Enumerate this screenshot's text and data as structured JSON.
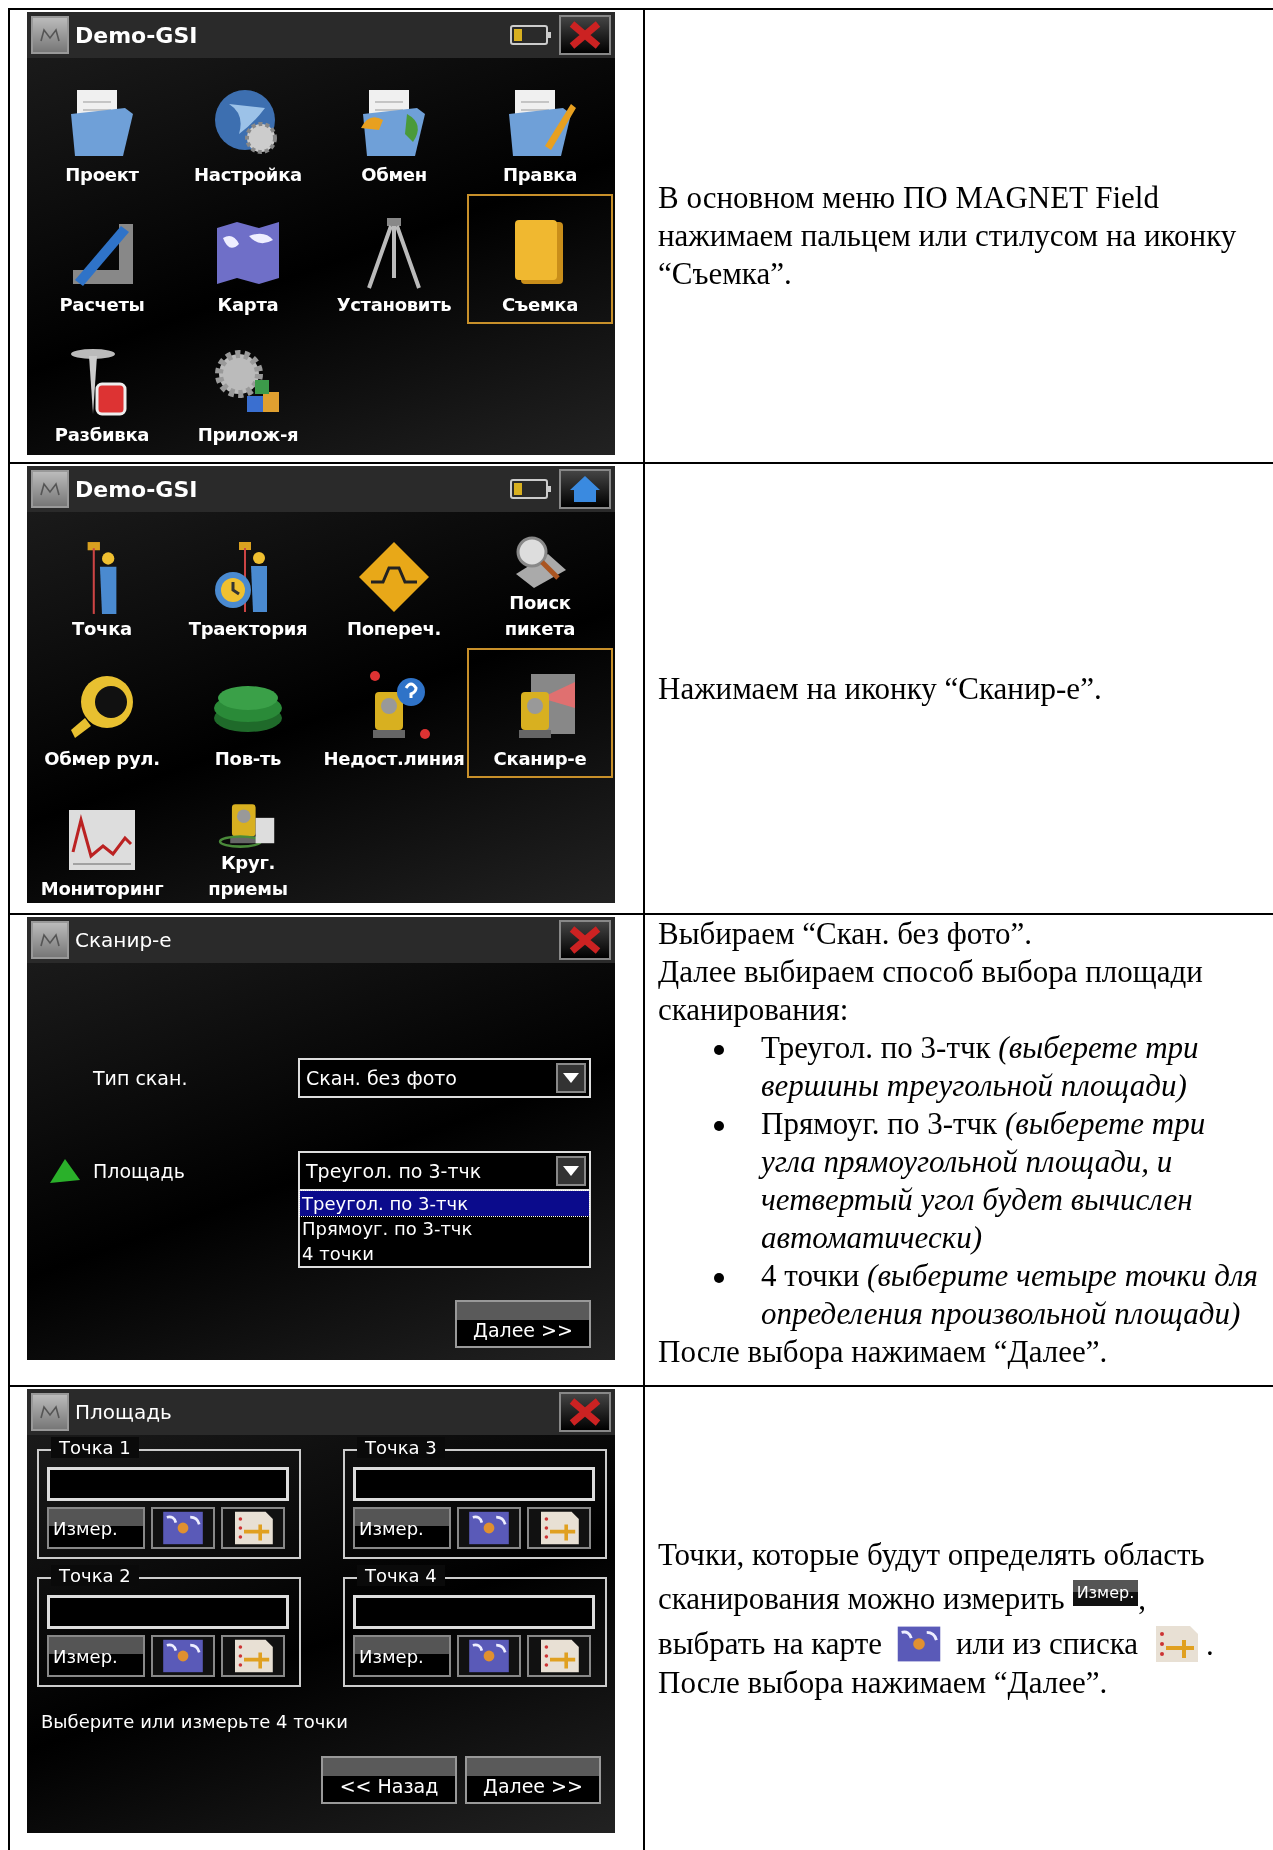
{
  "rows": [
    {
      "screen": {
        "kind": "menu",
        "title": "Demo-GSI",
        "corner_button": {
          "kind": "close"
        },
        "items": [
          {
            "label": "Проект",
            "selected": false
          },
          {
            "label": "Настройка",
            "selected": false
          },
          {
            "label": "Обмен",
            "selected": false
          },
          {
            "label": "Правка",
            "selected": false
          },
          {
            "label": "Расчеты",
            "selected": false
          },
          {
            "label": "Карта",
            "selected": false
          },
          {
            "label": "Установить",
            "selected": false
          },
          {
            "label": "Съемка",
            "selected": true
          },
          {
            "label": "Разбивка",
            "selected": false
          },
          {
            "label": "Прилож-я",
            "selected": false
          }
        ]
      },
      "description": [
        {
          "kind": "paragraph",
          "text": "В основном меню ПО MAGNET Field нажимаем пальцем или стилусом на иконку “Съемка”."
        }
      ]
    },
    {
      "screen": {
        "kind": "menu",
        "title": "Demo-GSI",
        "corner_button": {
          "kind": "home"
        },
        "items": [
          {
            "label": "Точка",
            "selected": false
          },
          {
            "label": "Траектория",
            "selected": false
          },
          {
            "label": "Попереч.",
            "selected": false
          },
          {
            "label": "Поиск\nпикета",
            "selected": false
          },
          {
            "label": "Обмер рул.",
            "selected": false
          },
          {
            "label": "Пов-ть",
            "selected": false
          },
          {
            "label": "Недост.линия",
            "selected": false
          },
          {
            "label": "Сканир-е",
            "selected": true
          },
          {
            "label": "Мониторинг",
            "selected": false
          },
          {
            "label": "Круг.\nприемы",
            "selected": false
          }
        ]
      },
      "description": [
        {
          "kind": "paragraph",
          "text": "Нажимаем на иконку “Сканир-е”."
        }
      ]
    },
    {
      "screen": {
        "kind": "form",
        "title": "Сканир-е",
        "corner_button": {
          "kind": "close"
        },
        "fields": [
          {
            "label": "Тип скан.",
            "value": "Скан. без фото"
          },
          {
            "label": "Площадь",
            "value": "Треугол. по 3-тчк",
            "options": [
              {
                "label": "Треугол. по 3-тчк",
                "selected": true
              },
              {
                "label": "Прямоуг. по 3-тчк",
                "selected": false
              },
              {
                "label": "4 точки",
                "selected": false
              }
            ]
          }
        ],
        "buttons": [
          "Далее >>"
        ]
      },
      "description": [
        {
          "kind": "paragraph",
          "text": "Выбираем “Скан. без фото”."
        },
        {
          "kind": "paragraph",
          "text": "Далее выбираем способ выбора площади сканирования:"
        },
        {
          "kind": "bullet",
          "text": "Треугол. по 3-тчк *(выберете три вершины треугольной площади)*"
        },
        {
          "kind": "bullet",
          "text": "Прямоуг. по 3-тчк *(выберете три угла прямоугольной площади, и четвертый угол будет вычислен автоматически)*"
        },
        {
          "kind": "bullet",
          "text": "4 точки *(выберите четыре точки для определения произвольной площади)*"
        },
        {
          "kind": "paragraph",
          "text": "После выбора нажимаем “Далее”."
        }
      ]
    },
    {
      "screen": {
        "kind": "points",
        "title": "Площадь",
        "corner_button": {
          "kind": "close"
        },
        "groups": [
          {
            "label": "Точка 1",
            "button": "Измер."
          },
          {
            "label": "Точка 3",
            "button": "Измер."
          },
          {
            "label": "Точка 2",
            "button": "Измер."
          },
          {
            "label": "Точка 4",
            "button": "Измер."
          }
        ],
        "hint": "Выберите или измерьте 4 точки",
        "buttons": [
          "<< Назад",
          "Далее >>"
        ]
      },
      "description": [
        {
          "kind": "inline",
          "parts": [
            {
              "kind": "text",
              "text": "Точки, которые будут определять область"
            },
            {
              "kind": "text",
              "text": "сканирования можно измерить"
            },
            {
              "kind": "button",
              "label": "Измер."
            },
            {
              "kind": "punct",
              "text": ","
            },
            {
              "kind": "text",
              "text": "выбрать на карте"
            },
            {
              "kind": "map_icon"
            },
            {
              "kind": "text",
              "text": "или из списка"
            },
            {
              "kind": "list_icon"
            },
            {
              "kind": "punct",
              "text": "."
            }
          ]
        },
        {
          "kind": "paragraph",
          "text": "После выбора нажимаем “Далее”."
        }
      ]
    }
  ]
}
